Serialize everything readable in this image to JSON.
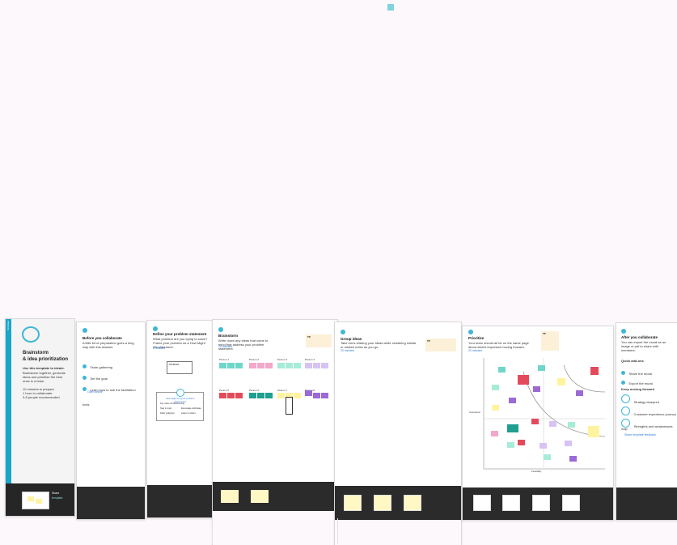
{
  "intro": {
    "tag": "Template",
    "title_line1": "Brainstorm",
    "title_line2": "& idea prioritization",
    "subtitle": "Use this template to ideate.",
    "description": "Brainstorm together, generate ideas and prioritize the best ones in a team.",
    "meta_items": [
      "10 minutes to prepare",
      "1 hour to collaborate",
      "3-8 people recommended"
    ],
    "footer_label": "Share",
    "footer_sublabel": "template"
  },
  "step1": {
    "title": "Before you collaborate",
    "text": "A little bit of preparation goes a long way with this session.",
    "items": [
      "Team gathering",
      "Set the goal",
      "Learn how to use the facilitation tools"
    ],
    "link": "Open article"
  },
  "step2": {
    "title": "Define your problem statement",
    "text": "What problem are you trying to solve? Frame your problem as a How Might We statement.",
    "link": "5 minutes",
    "box_title": "PROBLEM",
    "card_text": "How might we (your problem statement)?",
    "card_labels": [
      "Key rules of brainstorming",
      "Stay in topic",
      "Encourage wild ideas",
      "Defer judgment",
      "Listen to others",
      "Go for volume"
    ]
  },
  "step3": {
    "title": "Brainstorm",
    "text": "Write down any ideas that come to mind that address your problem statement.",
    "link": "10 minutes",
    "tip": "TIP",
    "groups": [
      "Person 1",
      "Person 2",
      "Person 3",
      "Person 4",
      "Person 5",
      "Person 6",
      "Person 7",
      "Person 8"
    ]
  },
  "step4": {
    "title": "Group ideas",
    "text": "Take turns sharing your ideas while clustering similar or related notes as you go.",
    "link": "20 minutes",
    "tip": "TIP"
  },
  "step5": {
    "title": "Prioritize",
    "text": "Your team should all be on the same page about what's important moving forward.",
    "link": "20 minutes",
    "tip": "TIP",
    "axis_x": "Feasibility",
    "axis_y": "Importance"
  },
  "step6": {
    "title": "After you collaborate",
    "text": "You can export the mural as an image or pdf to share with members.",
    "sections": [
      "Quick add-ons",
      "Keep moving forward"
    ],
    "items": [
      "Share the mural",
      "Export the mural",
      "Strategy blueprint",
      "Customer experience journey map",
      "Strengths and weaknesses"
    ],
    "link": "Share template feedback"
  },
  "colors": {
    "background": "#fdf8fc",
    "accent": "#3fb6d6",
    "footer": "#2b2b2b",
    "sticky_yellow": "#fff3a0",
    "sticky_teal": "#5ad1c2",
    "sticky_pink": "#f4a7c9",
    "sticky_purple": "#9b6ad6",
    "sticky_red": "#e34b5a",
    "sticky_lavender": "#d7c3f3"
  }
}
